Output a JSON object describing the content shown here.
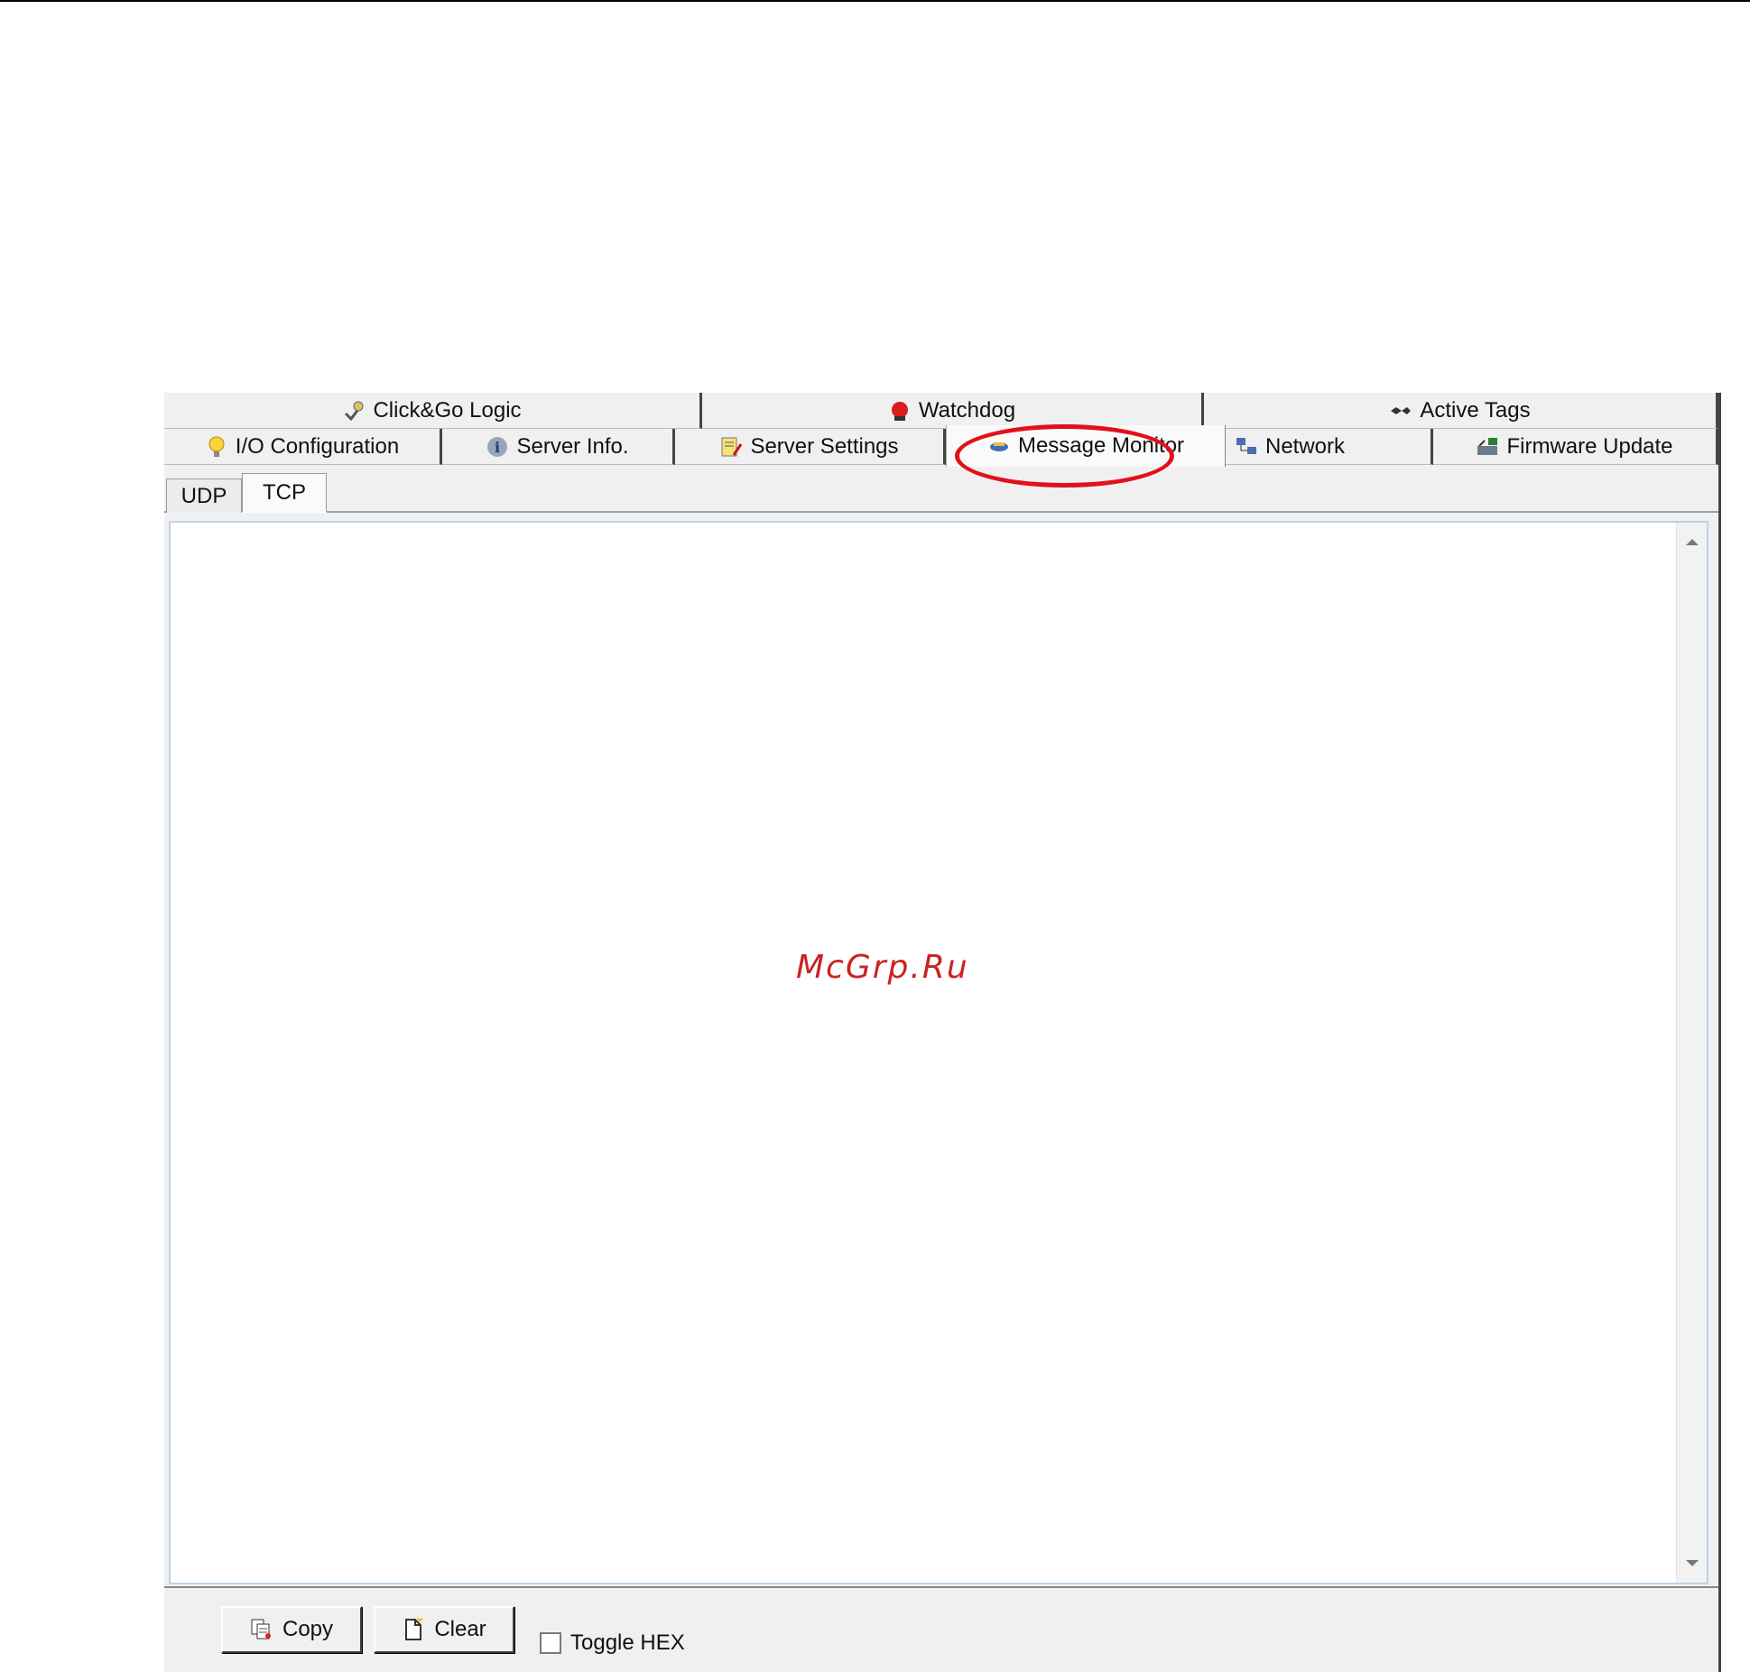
{
  "tabs": {
    "back_row": [
      {
        "label": "Click&Go Logic",
        "icon": "click-go-logic-icon"
      },
      {
        "label": "Watchdog",
        "icon": "watchdog-alarm-icon"
      },
      {
        "label": "Active Tags",
        "icon": "active-tags-icon"
      }
    ],
    "front_row": [
      {
        "label": "I/O Configuration",
        "icon": "lightbulb-icon"
      },
      {
        "label": "Server Info.",
        "icon": "info-icon"
      },
      {
        "label": "Server Settings",
        "icon": "settings-icon"
      },
      {
        "label": "Message Monitor",
        "icon": "monitor-icon",
        "active": true
      },
      {
        "label": "Network",
        "icon": "network-icon"
      },
      {
        "label": "Firmware Update",
        "icon": "firmware-icon"
      }
    ]
  },
  "subtabs": [
    {
      "label": "UDP",
      "active": false
    },
    {
      "label": "TCP",
      "active": true
    }
  ],
  "monitor": {
    "content": "",
    "watermark": "McGrp.Ru"
  },
  "toolbar": {
    "copy_label": "Copy",
    "clear_label": "Clear",
    "toggle_hex_label": "Toggle HEX",
    "toggle_hex_checked": false
  },
  "colors": {
    "highlight": "#e3101a",
    "watermark": "#cc2222"
  }
}
